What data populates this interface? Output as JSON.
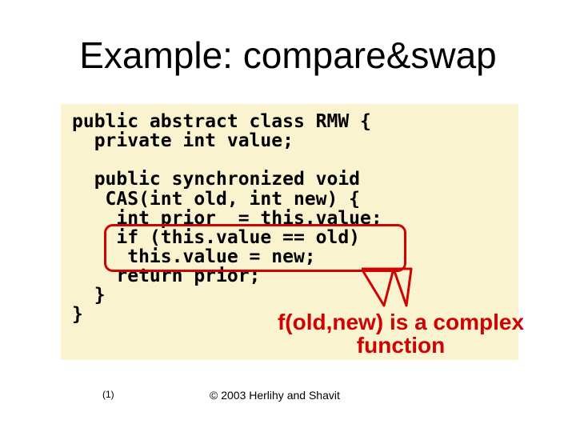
{
  "title": "Example: compare&swap",
  "code": {
    "line1": "public abstract class RMW {",
    "line2": "  private int value;",
    "line3": "",
    "line4": "  public synchronized void",
    "line5": "   CAS(int old, int new) {",
    "line6": "    int prior  = this.value;",
    "line7": "    if (this.value == old)",
    "line8": "     this.value = new;",
    "line9": "    return prior;",
    "line10": "  }",
    "line11": "}"
  },
  "callout": "f(old,new) is a complex function",
  "footer": {
    "pagenum": "(1)",
    "copyright": "© 2003 Herlihy and Shavit"
  },
  "colors": {
    "panel_bg": "#faf3cf",
    "accent": "#cf0304"
  }
}
